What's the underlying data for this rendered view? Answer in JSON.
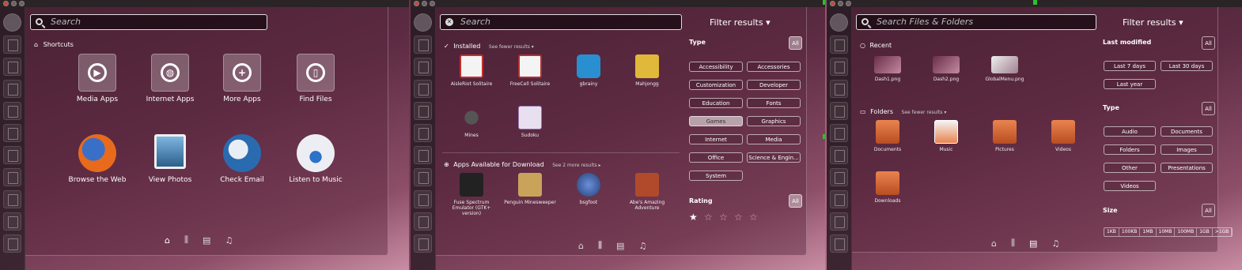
{
  "p1": {
    "search_placeholder": "Search",
    "shortcuts_label": "Shortcuts",
    "shortcuts": [
      {
        "label": "Media Apps",
        "glyph": "▶"
      },
      {
        "label": "Internet Apps",
        "glyph": "◍"
      },
      {
        "label": "More Apps",
        "glyph": "+"
      },
      {
        "label": "Find Files",
        "glyph": "▯"
      }
    ],
    "apps": [
      {
        "label": "Browse the Web",
        "icon": "firefox-icon",
        "color": "#e86a1c"
      },
      {
        "label": "View Photos",
        "icon": "photos-icon",
        "color": "#3a7fb0"
      },
      {
        "label": "Check Email",
        "icon": "thunderbird-icon",
        "color": "#2a6bb0"
      },
      {
        "label": "Listen to Music",
        "icon": "banshee-icon",
        "color": "#d9d9e6"
      }
    ]
  },
  "p2": {
    "filter_label": "Filter results ▾",
    "installed_label": "Installed",
    "installed_sub": "See fewer results ▾",
    "installed_apps": [
      {
        "label": "AisleRiot Solitaire",
        "color": "#c82d2d"
      },
      {
        "label": "FreeCell Solitaire",
        "color": "#b33030"
      },
      {
        "label": "gbrainy",
        "color": "#2a8fd1"
      },
      {
        "label": "Mahjongg",
        "color": "#e0b83a"
      },
      {
        "label": "Mines",
        "color": "#3a3a3a"
      },
      {
        "label": "Sudoku",
        "color": "#d8cde0"
      }
    ],
    "download_label": "Apps Available for Download",
    "download_sub": "See 2 more results ▸",
    "download_apps": [
      {
        "label": "Fuse Spectrum Emulator (GTK+ version)",
        "color": "#222"
      },
      {
        "label": "Penguin Minesweeper",
        "color": "#c9a35a"
      },
      {
        "label": "bsgfoot",
        "color": "#3b5fa8"
      },
      {
        "label": "Abe's Amazing Adventure",
        "color": "#b04a2a"
      }
    ],
    "type_title": "Type",
    "type_all": "All",
    "types": [
      "Accessibility",
      "Accessories",
      "Customization",
      "Developer",
      "Education",
      "Fonts",
      "Games",
      "Graphics",
      "Internet",
      "Media",
      "Office",
      "Science & Engin...",
      "System"
    ],
    "rating_title": "Rating",
    "rating_all": "All",
    "stars": [
      "★",
      "☆",
      "☆",
      "☆",
      "☆"
    ]
  },
  "p3": {
    "search_placeholder": "Search Files & Folders",
    "filter_label": "Filter results ▾",
    "recent_label": "Recent",
    "recent": [
      {
        "label": "Dash1.png"
      },
      {
        "label": "Dash2.png"
      },
      {
        "label": "GlobalMenu.png"
      }
    ],
    "folders_label": "Folders",
    "folders_sub": "See fewer results ▾",
    "folders": [
      {
        "label": "Documents"
      },
      {
        "label": "Music"
      },
      {
        "label": "Pictures"
      },
      {
        "label": "Videos"
      },
      {
        "label": "Downloads"
      }
    ],
    "lastmod_title": "Last modified",
    "lastmod_all": "All",
    "lastmod": [
      "Last 7 days",
      "Last 30 days",
      "Last year"
    ],
    "type_title": "Type",
    "type_all": "All",
    "types": [
      "Audio",
      "Documents",
      "Folders",
      "Images",
      "Other",
      "Presentations",
      "Videos"
    ],
    "size_title": "Size",
    "size_all": "All",
    "sizes": [
      "1KB",
      "100KB",
      "1MB",
      "10MB",
      "100MB",
      "1GB",
      ">1GB"
    ]
  },
  "dock_icons": [
    "⌂",
    "⫼",
    "▤",
    "♫"
  ]
}
